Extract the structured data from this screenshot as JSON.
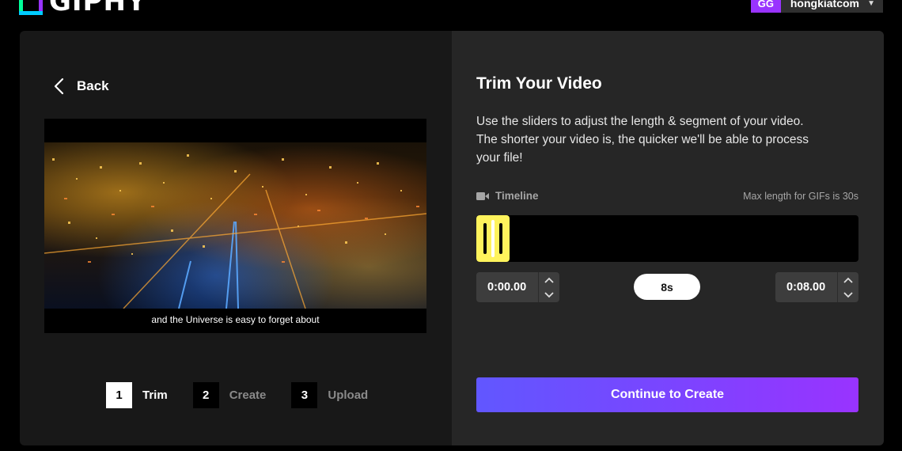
{
  "header": {
    "logo_text": "GIPHY",
    "account_initials": "GG",
    "account_name": "hongkiatcom"
  },
  "left": {
    "back_label": "Back",
    "video_caption": "and the Universe is easy to forget about",
    "steps": [
      {
        "num": "1",
        "label": "Trim",
        "active": true
      },
      {
        "num": "2",
        "label": "Create",
        "active": false
      },
      {
        "num": "3",
        "label": "Upload",
        "active": false
      }
    ]
  },
  "right": {
    "title": "Trim Your Video",
    "description": "Use the sliders to adjust the length & segment of your video. The shorter your video is, the quicker we'll be able to process your file!",
    "timeline_label": "Timeline",
    "max_length": "Max length for GIFs is 30s",
    "start_time": "0:00.00",
    "end_time": "0:08.00",
    "duration": "8s",
    "cta_label": "Continue to Create"
  },
  "colors": {
    "handle": "#fff35c",
    "cta_start": "#6157ff",
    "cta_end": "#9933ff",
    "avatar": "#9933ff"
  }
}
